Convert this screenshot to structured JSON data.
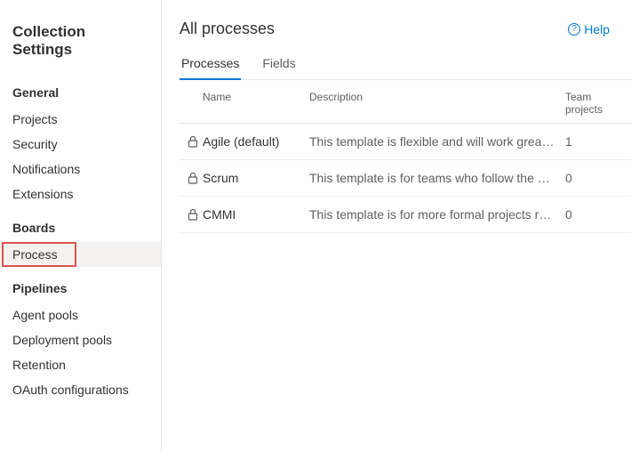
{
  "sidebar": {
    "title": "Collection Settings",
    "sections": [
      {
        "label": "General",
        "items": [
          {
            "label": "Projects"
          },
          {
            "label": "Security"
          },
          {
            "label": "Notifications"
          },
          {
            "label": "Extensions"
          }
        ]
      },
      {
        "label": "Boards",
        "items": [
          {
            "label": "Process",
            "selected": true,
            "highlighted": true
          }
        ]
      },
      {
        "label": "Pipelines",
        "items": [
          {
            "label": "Agent pools"
          },
          {
            "label": "Deployment pools"
          },
          {
            "label": "Retention"
          },
          {
            "label": "OAuth configurations"
          }
        ]
      }
    ]
  },
  "main": {
    "title": "All processes",
    "help_label": "Help",
    "tabs": [
      {
        "label": "Processes",
        "active": true
      },
      {
        "label": "Fields"
      }
    ],
    "columns": {
      "name": "Name",
      "description": "Description",
      "team": "Team projects"
    },
    "rows": [
      {
        "name": "Agile (default)",
        "description": "This template is flexible and will work great for most teams using Agile planning methods.",
        "team": "1"
      },
      {
        "name": "Scrum",
        "description": "This template is for teams who follow the Scrum framework.",
        "team": "0"
      },
      {
        "name": "CMMI",
        "description": "This template is for more formal projects requiring a framework for process improvement.",
        "team": "0"
      }
    ]
  }
}
